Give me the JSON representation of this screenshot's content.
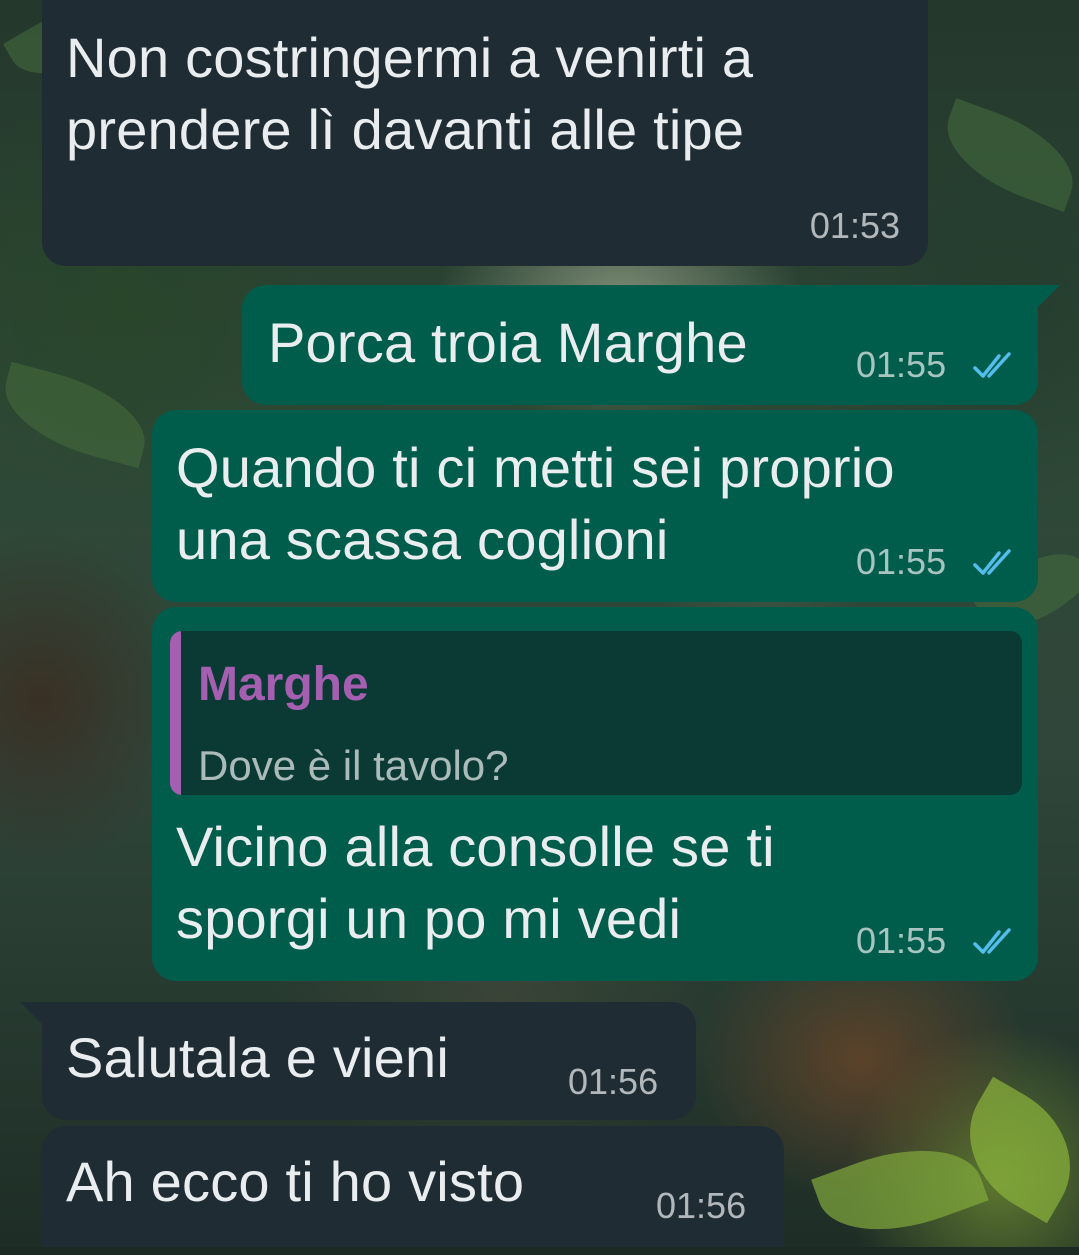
{
  "colors": {
    "incoming_bubble": "#202c33",
    "outgoing_bubble": "#005c4b",
    "quote_background": "#0b3a35",
    "quote_accent": "#a55fb0",
    "read_ticks": "#53bdeb"
  },
  "icons": {
    "read_receipt": "double-check-icon"
  },
  "messages": [
    {
      "direction": "incoming",
      "text": "Non costringermi a venirti a\nprendere lì davanti alle tipe",
      "time": "01:53"
    },
    {
      "direction": "outgoing",
      "text": "Porca troia Marghe",
      "time": "01:55",
      "status": "read"
    },
    {
      "direction": "outgoing",
      "text": "Quando ti ci metti sei proprio\nuna scassa coglioni",
      "time": "01:55",
      "status": "read"
    },
    {
      "direction": "outgoing",
      "quoted": {
        "author": "Marghe",
        "text": "Dove è il tavolo?"
      },
      "text": "Vicino alla consolle  se ti\nsporgi un po mi vedi",
      "time": "01:55",
      "status": "read"
    },
    {
      "direction": "incoming",
      "text": "Salutala e vieni",
      "time": "01:56"
    },
    {
      "direction": "incoming",
      "text": "Ah ecco ti ho visto",
      "time": "01:56"
    }
  ]
}
